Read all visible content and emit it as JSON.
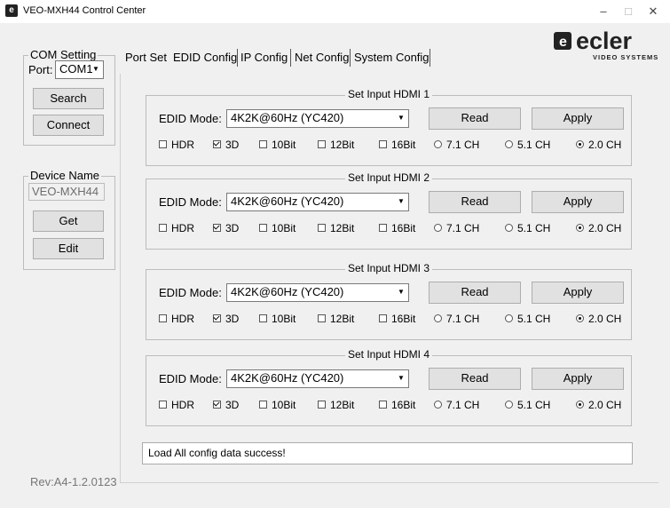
{
  "window": {
    "title": "VEO-MXH44 Control Center",
    "minimize": "–",
    "maximize": "□",
    "close": "✕"
  },
  "logo": {
    "brand": "ecler",
    "tagline": "VIDEO SYSTEMS"
  },
  "com": {
    "legend": "COM Setting",
    "port_label": "Port:",
    "port_value": "COM1",
    "search": "Search",
    "connect": "Connect"
  },
  "device": {
    "legend": "Device Name",
    "name": "VEO-MXH44",
    "get": "Get",
    "edit": "Edit"
  },
  "tabs": [
    "Port Set",
    "EDID Config",
    "IP Config",
    "Net Config",
    "System Config"
  ],
  "panels": [
    {
      "title": "Set Input HDMI  1",
      "edid_label": "EDID Mode:",
      "mode": "4K2K@60Hz (YC420)",
      "read": "Read",
      "apply": "Apply",
      "options": [
        "HDR",
        "3D",
        "10Bit",
        "12Bit",
        "16Bit",
        "7.1 CH",
        "5.1 CH",
        "2.0 CH"
      ]
    },
    {
      "title": "Set Input HDMI  2",
      "edid_label": "EDID Mode:",
      "mode": "4K2K@60Hz (YC420)",
      "read": "Read",
      "apply": "Apply",
      "options": [
        "HDR",
        "3D",
        "10Bit",
        "12Bit",
        "16Bit",
        "7.1 CH",
        "5.1 CH",
        "2.0 CH"
      ]
    },
    {
      "title": "Set Input HDMI  3",
      "edid_label": "EDID Mode:",
      "mode": "4K2K@60Hz (YC420)",
      "read": "Read",
      "apply": "Apply",
      "options": [
        "HDR",
        "3D",
        "10Bit",
        "12Bit",
        "16Bit",
        "7.1 CH",
        "5.1 CH",
        "2.0 CH"
      ]
    },
    {
      "title": "Set Input HDMI  4",
      "edid_label": "EDID Mode:",
      "mode": "4K2K@60Hz (YC420)",
      "read": "Read",
      "apply": "Apply",
      "options": [
        "HDR",
        "3D",
        "10Bit",
        "12Bit",
        "16Bit",
        "7.1 CH",
        "5.1 CH",
        "2.0 CH"
      ]
    }
  ],
  "checked": {
    "HDR": false,
    "3D": true,
    "10Bit": false,
    "12Bit": false,
    "16Bit": false
  },
  "audio_selected": "2.0 CH",
  "status": "Load All config data success!",
  "revision": "Rev:A4-1.2.0123"
}
